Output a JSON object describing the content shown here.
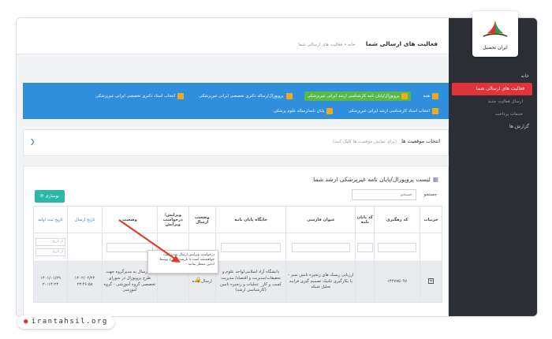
{
  "site": "irantahsil.org",
  "logo_text": "ایران تحصیل",
  "colors": {
    "accent": "#e0343a",
    "banner": "#2f8fdc",
    "teal": "#2cb8a6",
    "sidebar": "#2b2f34"
  },
  "sidebar": {
    "items": [
      {
        "label": "خانه"
      },
      {
        "label": "فعالیت های ارسالی شما",
        "active": true
      },
      {
        "label": "ارسال فعالیت جدید",
        "sub": true
      },
      {
        "label": "خدمات پرداخت",
        "sub": true
      },
      {
        "label": "گزارش ها"
      }
    ]
  },
  "header": {
    "title": "فعالیت های ارسالی شما",
    "breadcrumb": "خانه • فعالیت های ارسالی شما"
  },
  "banner": {
    "items": [
      {
        "num": "",
        "label": "همه",
        "selected": false
      },
      {
        "num": "",
        "label": "پروپوزال/پایان نامه کارشناسی ارشد ایرانی غیرپزشکی",
        "selected": true
      },
      {
        "num": "",
        "label": "پروپوزال/رساله دکتری تخصصی ایرانی غیرپزشکی",
        "selected": false
      },
      {
        "num": "",
        "label": "انتخاب استاد دکتری تخصصی ایرانی غیرپزشکی",
        "selected": false
      },
      {
        "num": "",
        "label": "انتخاب استاد کارشناسی ارشد ایرانی غیرپزشکی",
        "selected": false
      },
      {
        "num": "",
        "label": "پایان نامه/رساله علوم پزشکی",
        "selected": false
      }
    ]
  },
  "location": {
    "label": "انتخاب موقعیت ها",
    "hint": "(برای نمایش موقعیت ها کلیک کنید)"
  },
  "panel": {
    "title": "لیست پروپوزال/پایان نامه غیرپزشکی ارشد شما",
    "refresh_label": "نوسازی",
    "search_label": "جستجو",
    "search_placeholder": "جستجو"
  },
  "table": {
    "headers": [
      "جزییات",
      "کد رهگیری",
      "کد پایان نامه",
      "عنوان فارسی",
      "جایگاه پایان نامه",
      "وضعیت ارسال",
      "ویرایش/درخواست ویرایش",
      "وضعیت",
      "تاریخ ارسال",
      "تاریخ ثبت اولیه"
    ],
    "filter_placeholder": "از تاریخ",
    "row": {
      "code": "۱۴۲۷۷۵۰۹۷",
      "thesis_code": "",
      "title": "ارزیابی ریسک های زنجیره تامین سبز - با بکارگیری تکنیک تصمیم گیری فرایند تحلیل شبکه",
      "place": "دانشگاه آزاد اسلامی/واحد علوم و تحقیقات/مدیریت و اقتصاد/ مدیریت کسب و کار_ عملیات و زنجیره تامین (کارشناسی ارشد)",
      "send_status": "ارسال شده",
      "status": "۴- ارسال به مدیرگروه جهت طرح پروپوزال در شورای تخصصی گروه آموزشی - گروه آموزشی",
      "sent_date": "۱۴۰۲/۰۲/۲۲ ۲۳:۴۶:۵۸",
      "reg_date": "۱۴۰۱/۰۱/۲۹ ۲۰:۱۴:۲۴"
    }
  },
  "tooltip": "درخواست ویرایش ارسال شده است خواهشمند است تا بازشدن طرح توسط ادمین منتظر بمانید",
  "icons": {
    "lock": "lock-icon",
    "refresh": "refresh-icon",
    "plus": "plus-icon",
    "globe": "globe-icon"
  }
}
